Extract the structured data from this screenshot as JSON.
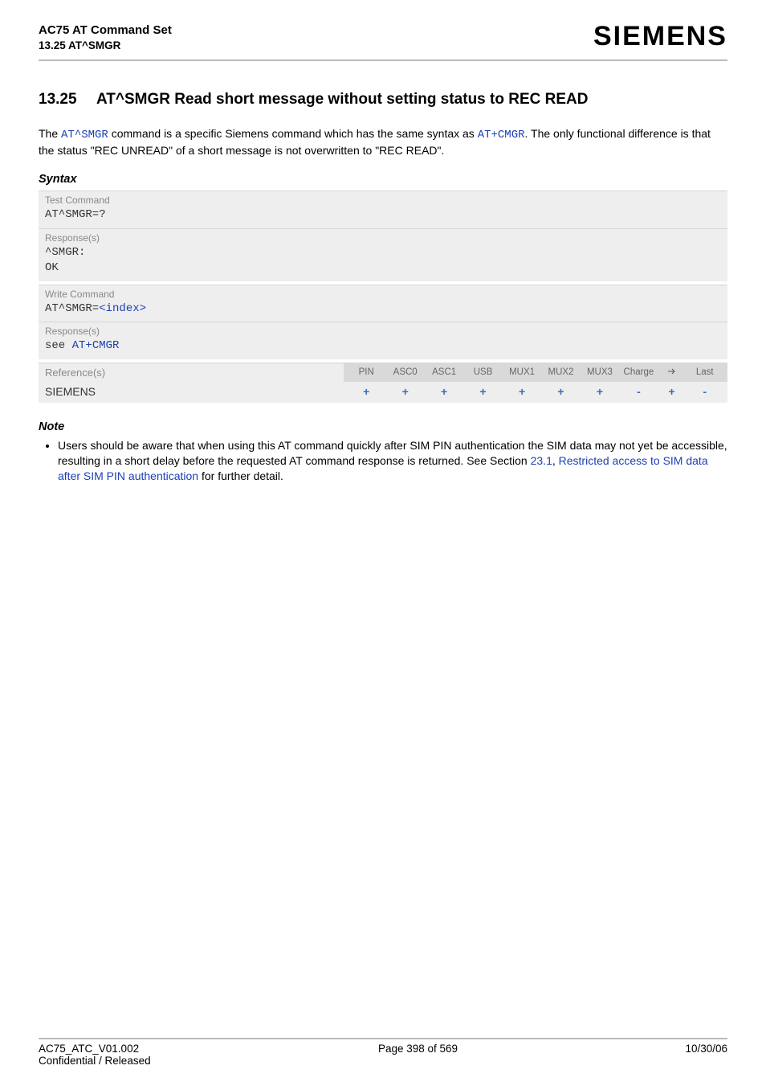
{
  "header": {
    "title": "AC75 AT Command Set",
    "subtitle": "13.25 AT^SMGR",
    "logo": "SIEMENS"
  },
  "section": {
    "num": "13.25",
    "title_pre": "AT^SMGR   Read short message without setting status to REC READ"
  },
  "intro": {
    "pre": "The ",
    "cmd1": "AT^SMGR",
    "mid": " command is a specific Siemens command which has the same syntax as ",
    "cmd2": "AT+CMGR",
    "post": ". The only functional difference is that the status \"REC UNREAD\" of a short message is not overwritten to \"REC READ\"."
  },
  "syntax": {
    "heading": "Syntax",
    "test_label": "Test Command",
    "test_cmd": "AT^SMGR=?",
    "resp_label": "Response(s)",
    "resp_line1": "^SMGR:",
    "resp_line2": "OK",
    "write_label": "Write Command",
    "write_cmd_pre": "AT^SMGR=",
    "write_cmd_param": "<index>",
    "resp2_label": "Response(s)",
    "resp2_pre": "see ",
    "resp2_link": "AT+CMGR"
  },
  "reftable": {
    "ref_label": "Reference(s)",
    "cols": [
      "PIN",
      "ASC0",
      "ASC1",
      "USB",
      "MUX1",
      "MUX2",
      "MUX3",
      "Charge",
      "",
      "Last"
    ],
    "vendor": "SIEMENS",
    "vals": [
      "+",
      "+",
      "+",
      "+",
      "+",
      "+",
      "+",
      "-",
      "+",
      "-"
    ]
  },
  "note": {
    "heading": "Note",
    "bullet_pre": "Users should be aware that when using this AT command quickly after SIM PIN authentication the SIM data may not yet be accessible, resulting in a short delay before the requested AT command response is returned. See Section ",
    "link1": "23.1",
    "sep": ", ",
    "link2": "Restricted access to SIM data after SIM PIN authentication",
    "post": " for further detail."
  },
  "footer": {
    "left1": "AC75_ATC_V01.002",
    "left2": "Confidential / Released",
    "center": "Page 398 of 569",
    "right": "10/30/06"
  }
}
